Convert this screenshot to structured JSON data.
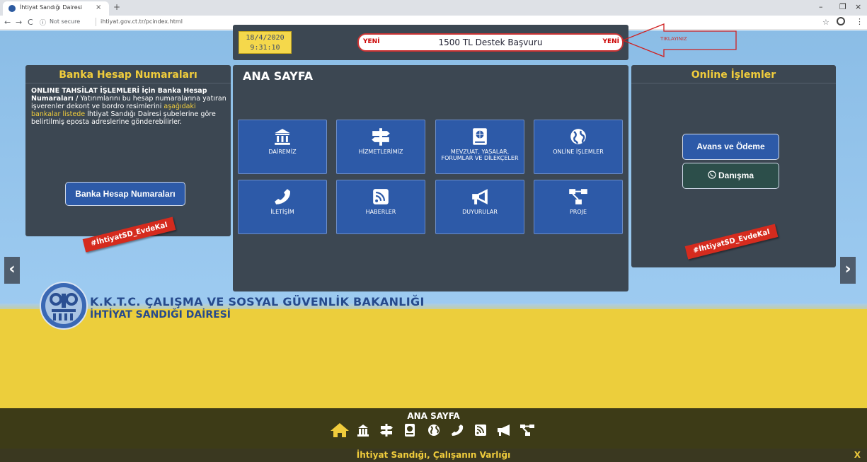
{
  "browser": {
    "tab_title": "İhtiyat Sandığı Dairesi",
    "tab_close": "×",
    "new_tab": "+",
    "not_secure": "Not secure",
    "url": "ihtiyat.gov.ct.tr/pcindex.html",
    "back": "←",
    "forward": "→",
    "reload": "C",
    "minimize": "–",
    "restore": "❐",
    "close": "×",
    "star": "☆",
    "menu": "⋮",
    "info": "ⓘ"
  },
  "header": {
    "date": "18/4/2020",
    "time": "9:31:10",
    "banner_left": "YENİ",
    "banner_text": "1500 TL Destek Başvuru",
    "banner_right": "YENİ",
    "annotation": "TIKLAYINIZ"
  },
  "left_panel": {
    "title": "Banka Hesap Numaraları",
    "text_bold": "ONLINE TAHSİLAT İŞLEMLERİ İçin Banka Hesap Numaraları /",
    "text_1": " Yatırımlarını bu hesap numaralarına yatıran işverenler dekont ve bordro resimlerini ",
    "text_link": "aşağıdaki bankalar listede",
    "text_2": " İhtiyat Sandığı Dairesi şubelerine göre belirtilmiş eposta adreslerine gönderebilirler.",
    "button": "Banka Hesap Numaraları",
    "hashtag": "#İhtiyatSD_EvdeKal"
  },
  "center_panel": {
    "title": "ANA SAYFA",
    "tiles": [
      {
        "label": "DAİREMİZ",
        "icon": "bank-icon"
      },
      {
        "label": "HİZMETLERİMİZ",
        "icon": "signpost-icon"
      },
      {
        "label": "MEVZUAT, YASALAR, FORUMLAR VE DİLEKÇELER",
        "icon": "law-book-icon"
      },
      {
        "label": "ONLİNE İŞLEMLER",
        "icon": "globe-icon"
      },
      {
        "label": "İLETİŞİM",
        "icon": "phone-icon"
      },
      {
        "label": "HABERLER",
        "icon": "rss-icon"
      },
      {
        "label": "DUYURULAR",
        "icon": "megaphone-icon"
      },
      {
        "label": "PROJE",
        "icon": "sitemap-icon"
      }
    ]
  },
  "right_panel": {
    "title": "Online İşlemler",
    "button_avans": "Avans ve Ödeme",
    "button_danisma": "Danışma",
    "hashtag": "#İhtiyatSD_EvdeKal"
  },
  "nav": {
    "prev": "‹",
    "next": "›"
  },
  "branding": {
    "ministry": "K.K.T.C. ÇALIŞMA VE SOSYAL GÜVENLİK BAKANLIĞI",
    "directorate": "İHTİYAT SANDIĞI DAİRESİ"
  },
  "footer": {
    "title": "ANA SAYFA",
    "slogan": "İhtiyat Sandığı, Çalışanın Varlığı",
    "close": "X",
    "icons": [
      "home-icon",
      "bank-icon",
      "signpost-icon",
      "law-book-icon",
      "globe-icon",
      "phone-icon",
      "rss-icon",
      "megaphone-icon",
      "sitemap-icon"
    ]
  },
  "colors": {
    "panel": "#3c4752",
    "accent_yellow": "#f0cc3c",
    "tile_blue": "#2d5aa8",
    "badge_red": "#d52b1e"
  }
}
